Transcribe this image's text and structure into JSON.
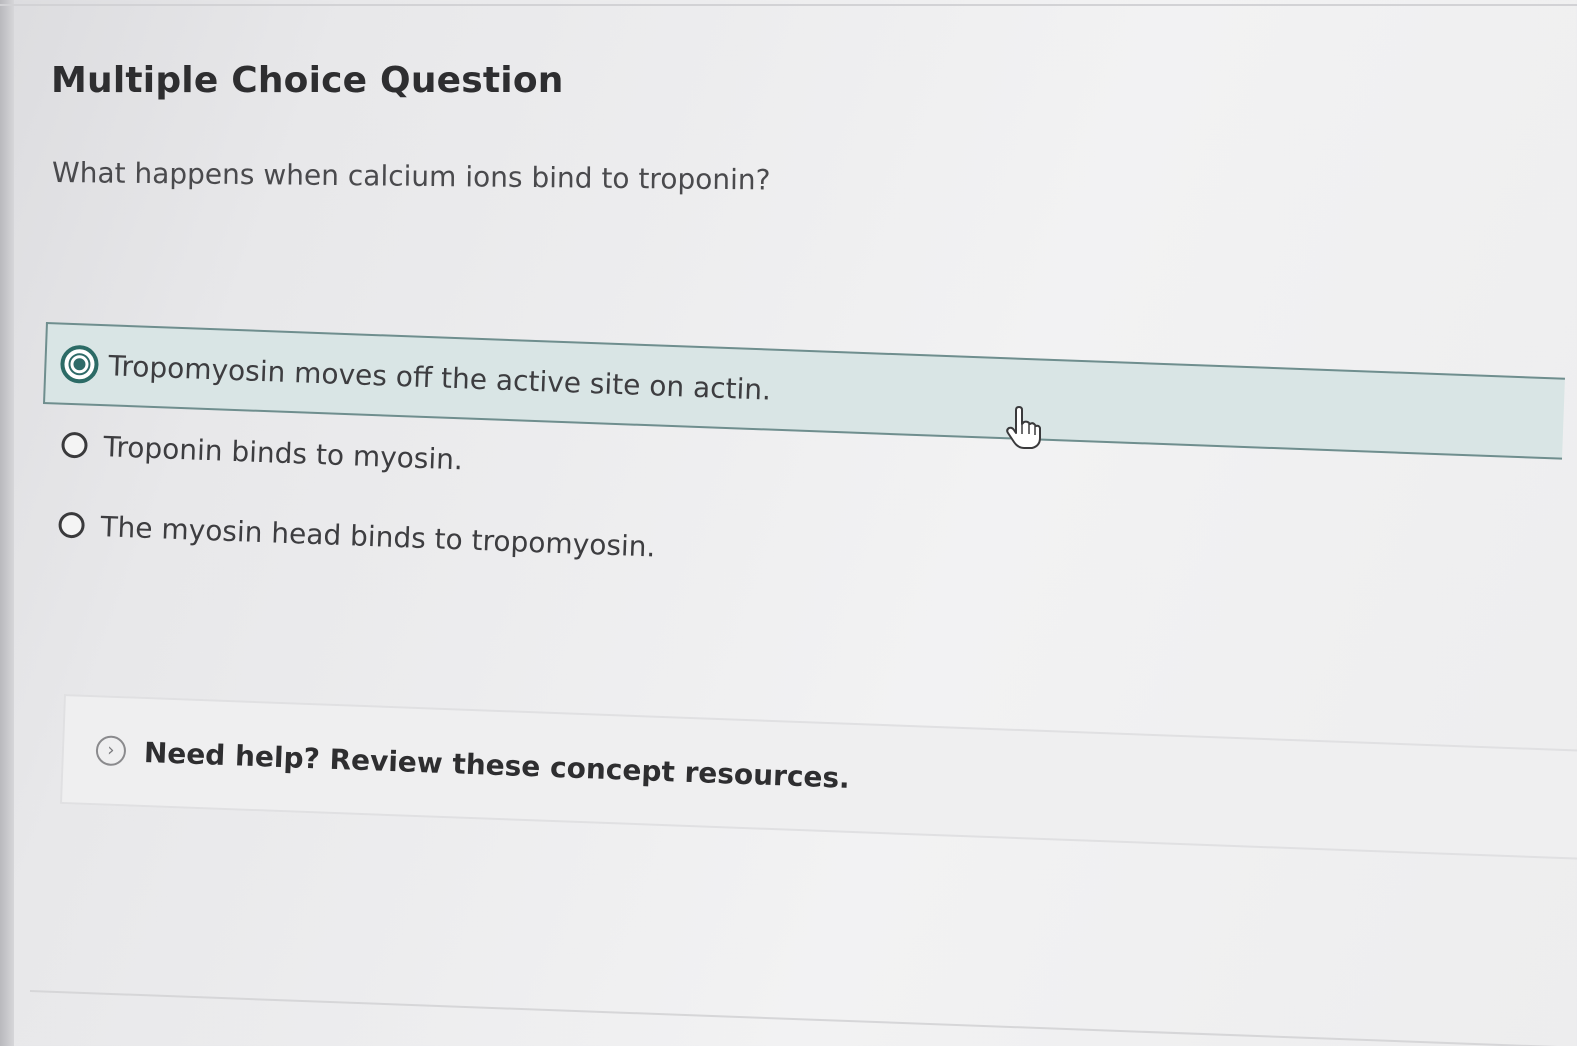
{
  "question": {
    "heading": "Multiple Choice Question",
    "prompt": "What happens when calcium ions bind to troponin?"
  },
  "options": [
    {
      "label": "Tropomyosin moves off the active site on actin.",
      "selected": true
    },
    {
      "label": "Troponin binds to myosin.",
      "selected": false
    },
    {
      "label": "The myosin head binds to tropomyosin.",
      "selected": false
    }
  ],
  "help": {
    "label": "Need help? Review these concept resources.",
    "icon": "chevron-right-icon"
  },
  "colors": {
    "accent": "#2f6b69",
    "selected_background": "#d9e5e5",
    "selected_border": "#6f8e8e"
  }
}
